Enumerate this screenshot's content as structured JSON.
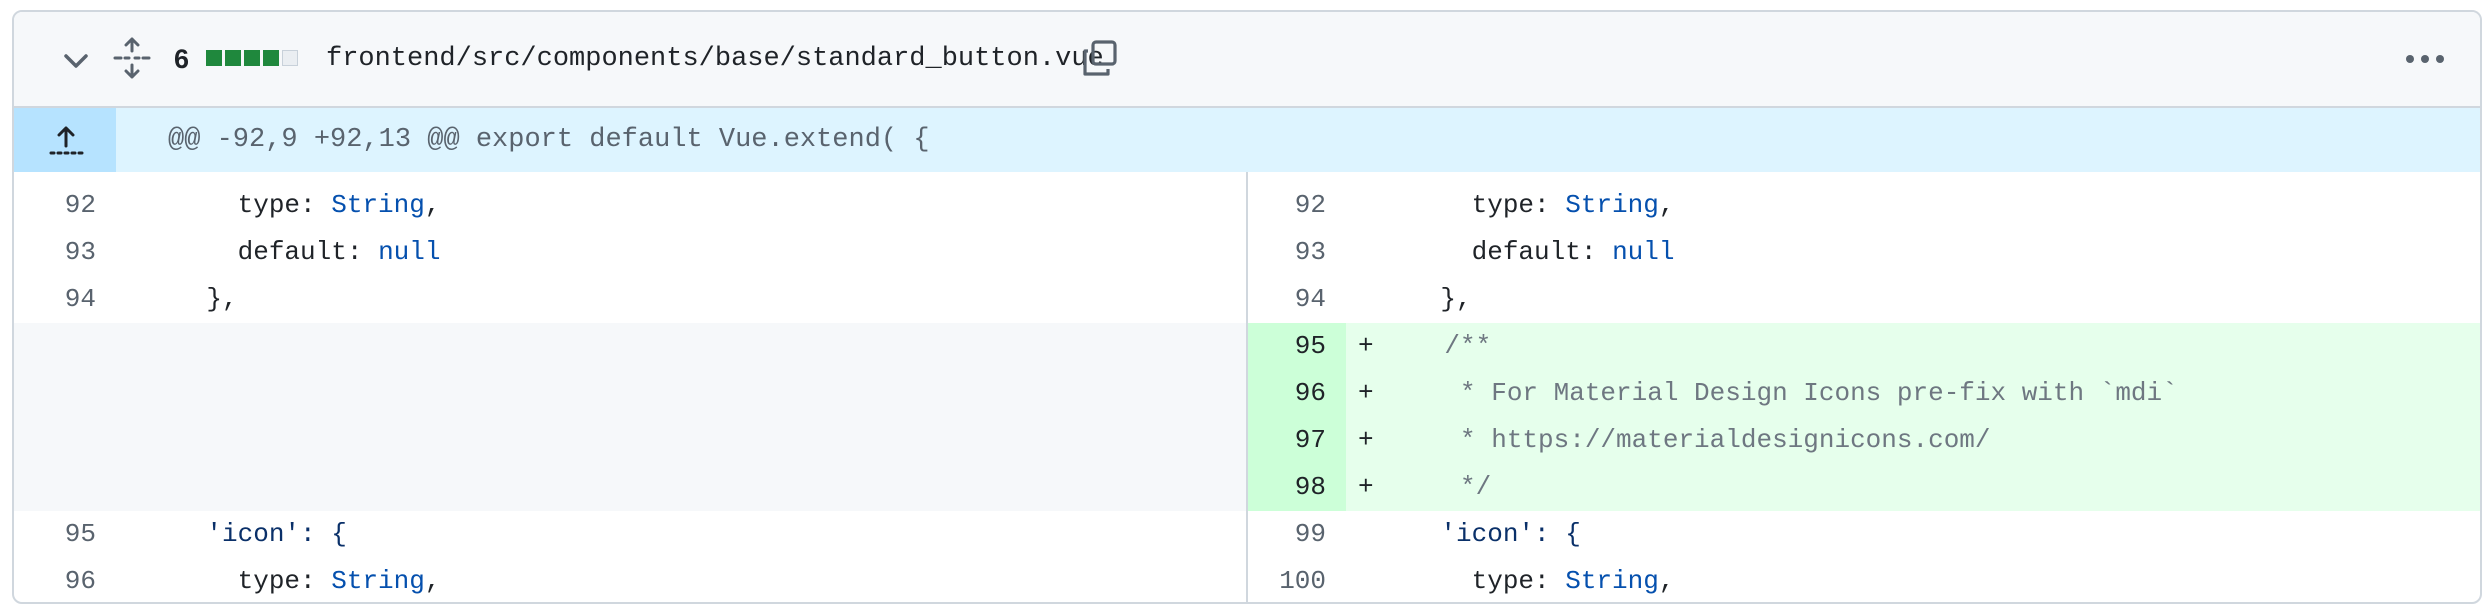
{
  "file": {
    "change_count": "6",
    "diffstat": [
      "add",
      "add",
      "add",
      "add",
      "neutral"
    ],
    "path": "frontend/src/components/base/standard_button.vue",
    "icons": {
      "collapse": "chevron-down-icon",
      "expand": "expand-all-icon",
      "copy": "copy-icon",
      "menu": "kebab-horizontal-icon"
    },
    "colors": {
      "added_bg": "#e6ffec",
      "added_gutter": "#ccffd8",
      "hunk_bg": "#ddf4ff",
      "diffstat_add": "#1f883d"
    }
  },
  "hunk": {
    "header": "@@ -92,9 +92,13 @@ export default Vue.extend( {"
  },
  "left": [
    {
      "num": "92",
      "indent": "      ",
      "key": "type: ",
      "value": "String",
      "tail": ","
    },
    {
      "num": "93",
      "indent": "      ",
      "key": "default: ",
      "value": "null",
      "tail": ""
    },
    {
      "num": "94",
      "indent": "    ",
      "key": "},",
      "value": "",
      "tail": ""
    },
    {
      "num": "95",
      "indent": "    ",
      "key": "'icon': {",
      "value": "",
      "tail": ""
    },
    {
      "num": "96",
      "indent": "      ",
      "key": "type: ",
      "value": "String",
      "tail": ","
    }
  ],
  "right": [
    {
      "num": "92",
      "indent": "      ",
      "key": "type: ",
      "value": "String",
      "tail": ","
    },
    {
      "num": "93",
      "indent": "      ",
      "key": "default: ",
      "value": "null",
      "tail": ""
    },
    {
      "num": "94",
      "indent": "    ",
      "key": "},",
      "value": "",
      "tail": ""
    },
    {
      "num": "95",
      "marker": "+",
      "text": "    /**"
    },
    {
      "num": "96",
      "marker": "+",
      "text": "     * For Material Design Icons pre-fix with `mdi`"
    },
    {
      "num": "97",
      "marker": "+",
      "text": "     * https://materialdesignicons.com/"
    },
    {
      "num": "98",
      "marker": "+",
      "text": "     */"
    },
    {
      "num": "99",
      "indent": "    ",
      "key": "'icon': {",
      "value": "",
      "tail": ""
    },
    {
      "num": "100",
      "indent": "      ",
      "key": "type: ",
      "value": "String",
      "tail": ","
    }
  ]
}
